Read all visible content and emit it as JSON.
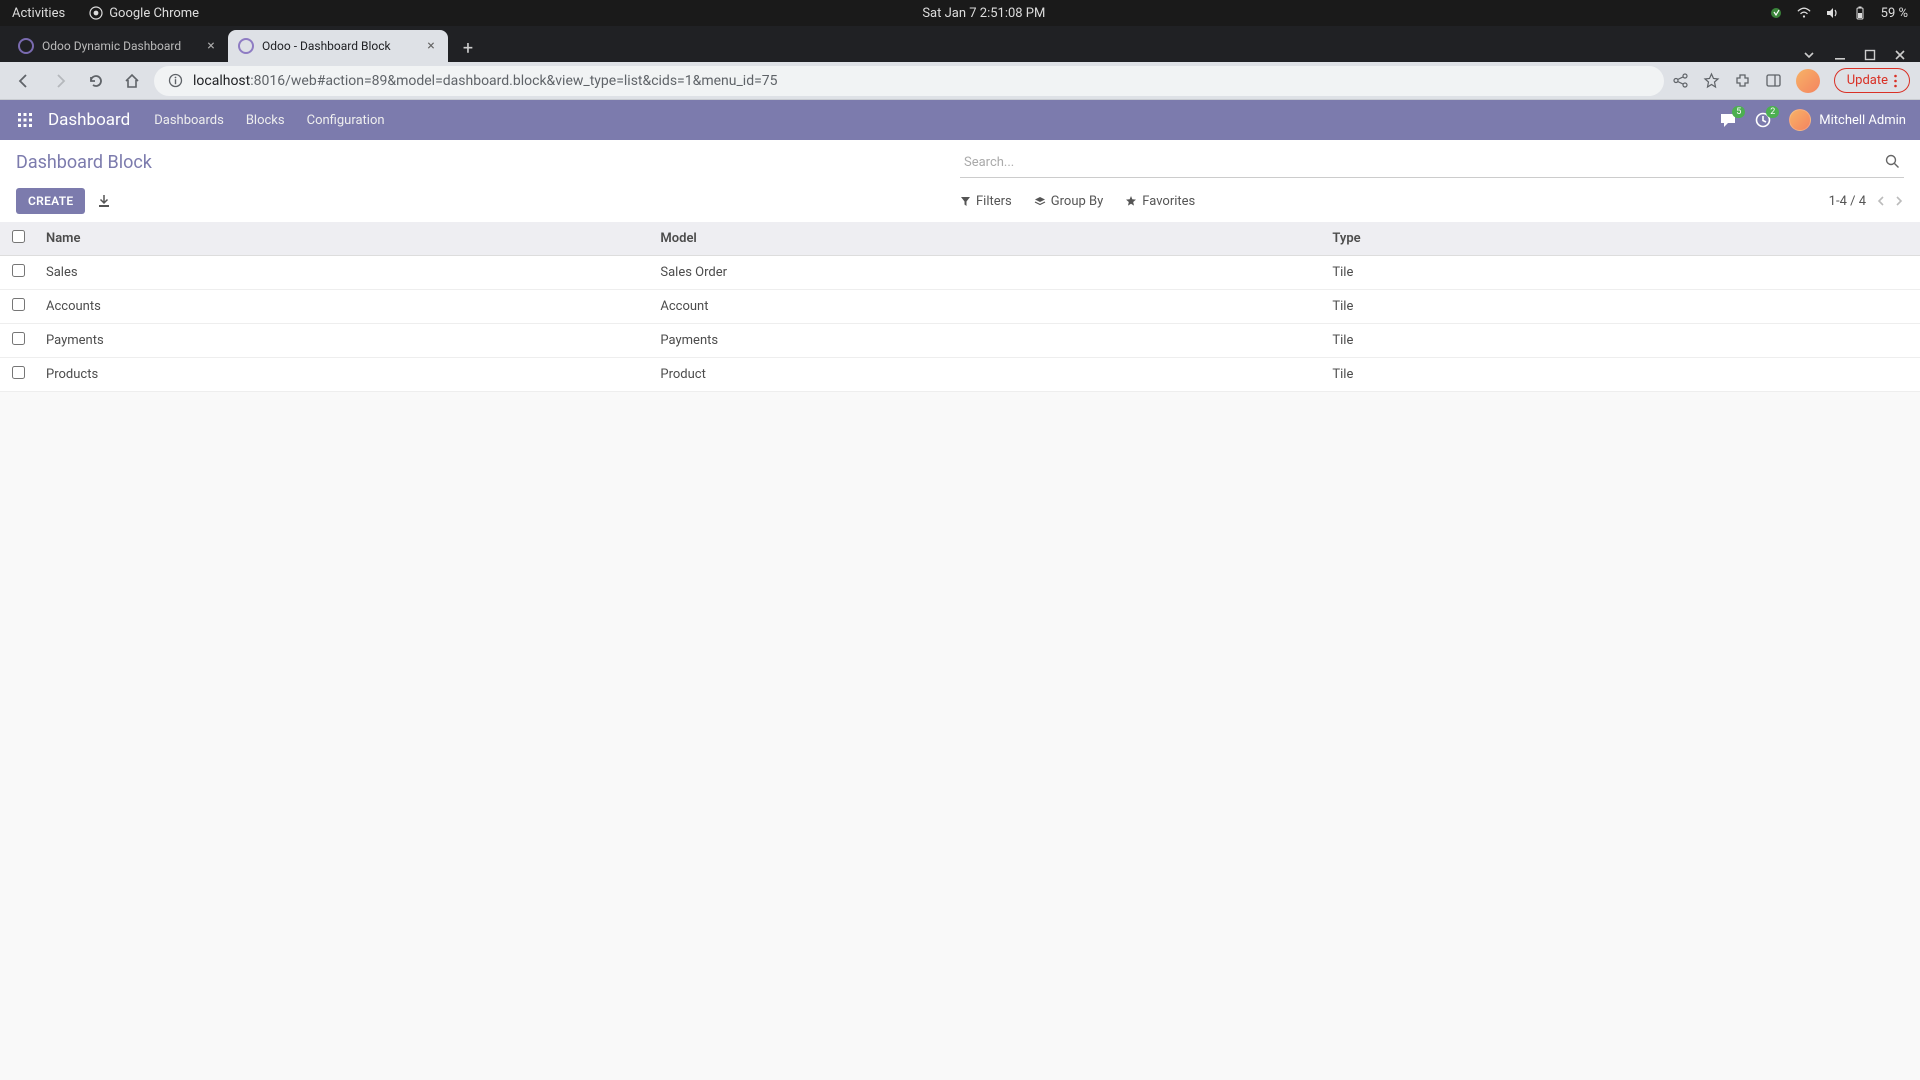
{
  "gnome": {
    "activities": "Activities",
    "app_name": "Google Chrome",
    "datetime": "Sat Jan 7  2:51:08 PM",
    "battery": "59 %"
  },
  "chrome": {
    "tabs": [
      {
        "title": "Odoo Dynamic Dashboard",
        "active": false
      },
      {
        "title": "Odoo - Dashboard Block",
        "active": true
      }
    ],
    "url_host": "localhost",
    "url_port": ":8016",
    "url_path": "/web#action=89&model=dashboard.block&view_type=list&cids=1&menu_id=75",
    "update_label": "Update"
  },
  "odoo_nav": {
    "app_title": "Dashboard",
    "menu": [
      "Dashboards",
      "Blocks",
      "Configuration"
    ],
    "msg_badge": "5",
    "clock_badge": "2",
    "user_name": "Mitchell Admin"
  },
  "control": {
    "breadcrumb": "Dashboard Block",
    "search_placeholder": "Search...",
    "create_label": "CREATE",
    "filters_label": "Filters",
    "groupby_label": "Group By",
    "favorites_label": "Favorites",
    "pager_text": "1-4 / 4"
  },
  "table": {
    "headers": {
      "name": "Name",
      "model": "Model",
      "type": "Type"
    },
    "rows": [
      {
        "name": "Sales",
        "model": "Sales Order",
        "type": "Tile"
      },
      {
        "name": "Accounts",
        "model": "Account",
        "type": "Tile"
      },
      {
        "name": "Payments",
        "model": "Payments",
        "type": "Tile"
      },
      {
        "name": "Products",
        "model": "Product",
        "type": "Tile"
      }
    ]
  }
}
